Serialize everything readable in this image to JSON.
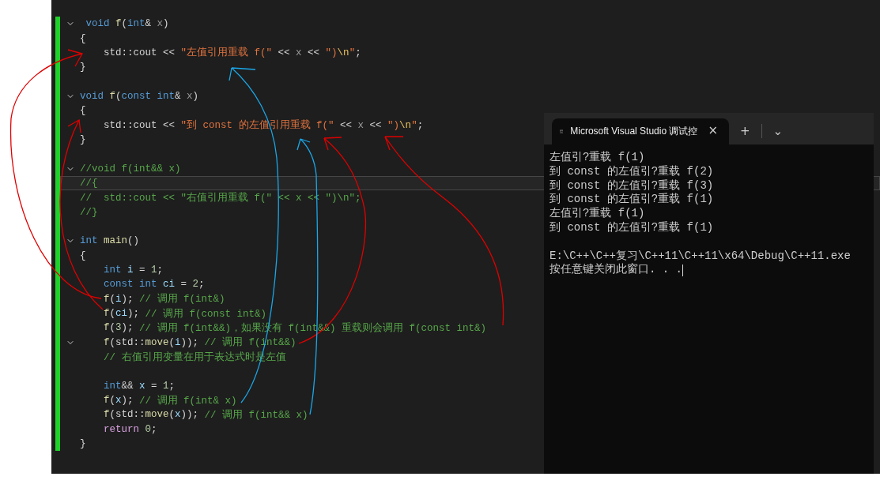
{
  "editor": {
    "lines": [
      {
        "fold": true,
        "current": false,
        "tokens": [
          {
            "kind": "keyword",
            "text": " void"
          },
          {
            "kind": "function",
            "text": " f"
          },
          {
            "kind": "punct",
            "text": "("
          },
          {
            "kind": "keyword",
            "text": "int"
          },
          {
            "kind": "punct",
            "text": "& "
          },
          {
            "kind": "param",
            "text": "x"
          },
          {
            "kind": "punct",
            "text": ")"
          }
        ]
      },
      {
        "fold": false,
        "current": false,
        "tokens": [
          {
            "kind": "punct",
            "text": "{"
          }
        ]
      },
      {
        "fold": false,
        "current": false,
        "tokens": [
          {
            "kind": "punct",
            "text": "    std::cout << "
          },
          {
            "kind": "string",
            "text": "\"左值引用重载 f(\""
          },
          {
            "kind": "punct",
            "text": " << "
          },
          {
            "kind": "param",
            "text": "x"
          },
          {
            "kind": "punct",
            "text": " << "
          },
          {
            "kind": "string",
            "text": "\")"
          },
          {
            "kind": "escape",
            "text": "\\n"
          },
          {
            "kind": "string",
            "text": "\""
          },
          {
            "kind": "punct",
            "text": ";"
          }
        ]
      },
      {
        "fold": false,
        "current": false,
        "tokens": [
          {
            "kind": "punct",
            "text": "}"
          }
        ]
      },
      {
        "fold": false,
        "current": false
      },
      {
        "fold": true,
        "current": false,
        "tokens": [
          {
            "kind": "keyword",
            "text": "void"
          },
          {
            "kind": "function",
            "text": " f"
          },
          {
            "kind": "punct",
            "text": "("
          },
          {
            "kind": "keyword",
            "text": "const int"
          },
          {
            "kind": "punct",
            "text": "& "
          },
          {
            "kind": "param",
            "text": "x"
          },
          {
            "kind": "punct",
            "text": ")"
          }
        ]
      },
      {
        "fold": false,
        "current": false,
        "tokens": [
          {
            "kind": "punct",
            "text": "{"
          }
        ]
      },
      {
        "fold": false,
        "current": false,
        "tokens": [
          {
            "kind": "punct",
            "text": "    std::cout << "
          },
          {
            "kind": "string",
            "text": "\"到 const 的左值引用重载 f(\""
          },
          {
            "kind": "punct",
            "text": " << "
          },
          {
            "kind": "param",
            "text": "x"
          },
          {
            "kind": "punct",
            "text": " << "
          },
          {
            "kind": "string",
            "text": "\")"
          },
          {
            "kind": "escape",
            "text": "\\n"
          },
          {
            "kind": "string",
            "text": "\""
          },
          {
            "kind": "punct",
            "text": ";"
          }
        ]
      },
      {
        "fold": false,
        "current": false,
        "tokens": [
          {
            "kind": "punct",
            "text": "}"
          }
        ]
      },
      {
        "fold": false,
        "current": false
      },
      {
        "fold": true,
        "current": false,
        "tokens": [
          {
            "kind": "comment",
            "text": "//void f(int&& x)"
          }
        ]
      },
      {
        "fold": false,
        "current": true,
        "tokens": [
          {
            "kind": "comment",
            "text": "//{"
          }
        ]
      },
      {
        "fold": false,
        "current": false,
        "tokens": [
          {
            "kind": "comment",
            "text": "//  std::cout << \"右值引用重载 f(\" << x << \")\\n\";"
          }
        ]
      },
      {
        "fold": false,
        "current": false,
        "tokens": [
          {
            "kind": "comment",
            "text": "//}"
          }
        ]
      },
      {
        "fold": false,
        "current": false
      },
      {
        "fold": true,
        "current": false,
        "tokens": [
          {
            "kind": "keyword",
            "text": "int"
          },
          {
            "kind": "function",
            "text": " main"
          },
          {
            "kind": "punct",
            "text": "()"
          }
        ]
      },
      {
        "fold": false,
        "current": false,
        "tokens": [
          {
            "kind": "punct",
            "text": "{"
          }
        ]
      },
      {
        "fold": false,
        "current": false,
        "tokens": [
          {
            "kind": "keyword",
            "text": "    int"
          },
          {
            "kind": "variable",
            "text": " i"
          },
          {
            "kind": "punct",
            "text": " = "
          },
          {
            "kind": "number",
            "text": "1"
          },
          {
            "kind": "punct",
            "text": ";"
          }
        ]
      },
      {
        "fold": false,
        "current": false,
        "tokens": [
          {
            "kind": "keyword",
            "text": "    const int"
          },
          {
            "kind": "variable",
            "text": " ci"
          },
          {
            "kind": "punct",
            "text": " = "
          },
          {
            "kind": "number",
            "text": "2"
          },
          {
            "kind": "punct",
            "text": ";"
          }
        ]
      },
      {
        "fold": false,
        "current": false,
        "tokens": [
          {
            "kind": "function",
            "text": "    f"
          },
          {
            "kind": "punct",
            "text": "("
          },
          {
            "kind": "variable",
            "text": "i"
          },
          {
            "kind": "punct",
            "text": "); "
          },
          {
            "kind": "comment",
            "text": "// 调用 f(int&)"
          }
        ]
      },
      {
        "fold": false,
        "current": false,
        "tokens": [
          {
            "kind": "function",
            "text": "    f"
          },
          {
            "kind": "punct",
            "text": "("
          },
          {
            "kind": "variable",
            "text": "ci"
          },
          {
            "kind": "punct",
            "text": "); "
          },
          {
            "kind": "comment",
            "text": "// 调用 f(const int&)"
          }
        ]
      },
      {
        "fold": false,
        "current": false,
        "tokens": [
          {
            "kind": "function",
            "text": "    f"
          },
          {
            "kind": "punct",
            "text": "("
          },
          {
            "kind": "number",
            "text": "3"
          },
          {
            "kind": "punct",
            "text": "); "
          },
          {
            "kind": "comment",
            "text": "// 调用 f(int&&)，如果没有 f(int&&) 重载则会调用 f(const int&)"
          }
        ]
      },
      {
        "fold": true,
        "current": false,
        "tokens": [
          {
            "kind": "function",
            "text": "    f"
          },
          {
            "kind": "punct",
            "text": "(std::"
          },
          {
            "kind": "function",
            "text": "move"
          },
          {
            "kind": "punct",
            "text": "("
          },
          {
            "kind": "variable",
            "text": "i"
          },
          {
            "kind": "punct",
            "text": ")); "
          },
          {
            "kind": "comment",
            "text": "// 调用 f(int&&)"
          }
        ]
      },
      {
        "fold": false,
        "current": false,
        "tokens": [
          {
            "kind": "comment",
            "text": "    // 右值引用变量在用于表达式时是左值"
          }
        ]
      },
      {
        "fold": false,
        "current": false
      },
      {
        "fold": false,
        "current": false,
        "tokens": [
          {
            "kind": "keyword",
            "text": "    int"
          },
          {
            "kind": "punct",
            "text": "&& "
          },
          {
            "kind": "variable",
            "text": "x"
          },
          {
            "kind": "punct",
            "text": " = "
          },
          {
            "kind": "number",
            "text": "1"
          },
          {
            "kind": "punct",
            "text": ";"
          }
        ]
      },
      {
        "fold": false,
        "current": false,
        "tokens": [
          {
            "kind": "function",
            "text": "    f"
          },
          {
            "kind": "punct",
            "text": "("
          },
          {
            "kind": "variable",
            "text": "x"
          },
          {
            "kind": "punct",
            "text": "); "
          },
          {
            "kind": "comment",
            "text": "// 调用 f(int& x)"
          }
        ]
      },
      {
        "fold": false,
        "current": false,
        "tokens": [
          {
            "kind": "function",
            "text": "    f"
          },
          {
            "kind": "punct",
            "text": "(std::"
          },
          {
            "kind": "function",
            "text": "move"
          },
          {
            "kind": "punct",
            "text": "("
          },
          {
            "kind": "variable",
            "text": "x"
          },
          {
            "kind": "punct",
            "text": ")); "
          },
          {
            "kind": "comment",
            "text": "// 调用 f(int&& x)"
          }
        ]
      },
      {
        "fold": false,
        "current": false,
        "tokens": [
          {
            "kind": "control",
            "text": "    return "
          },
          {
            "kind": "number",
            "text": "0"
          },
          {
            "kind": "punct",
            "text": ";"
          }
        ]
      },
      {
        "fold": false,
        "current": false,
        "tokens": [
          {
            "kind": "punct",
            "text": "}"
          }
        ]
      }
    ]
  },
  "terminal": {
    "tab": {
      "title": "Microsoft Visual Studio 调试控",
      "close": "×"
    },
    "new_tab": "+",
    "dropdown": "⌄",
    "output": [
      "左值引?重载 f(1)",
      "到 const 的左值引?重载 f(2)",
      "到 const 的左值引?重载 f(3)",
      "到 const 的左值引?重载 f(1)",
      "左值引?重载 f(1)",
      "到 const 的左值引?重载 f(1)"
    ],
    "exit_message": [
      "E:\\C++\\C++复习\\C++11\\C++11\\x64\\Debug\\C++11.exe",
      "按任意键关闭此窗口. . ."
    ]
  }
}
